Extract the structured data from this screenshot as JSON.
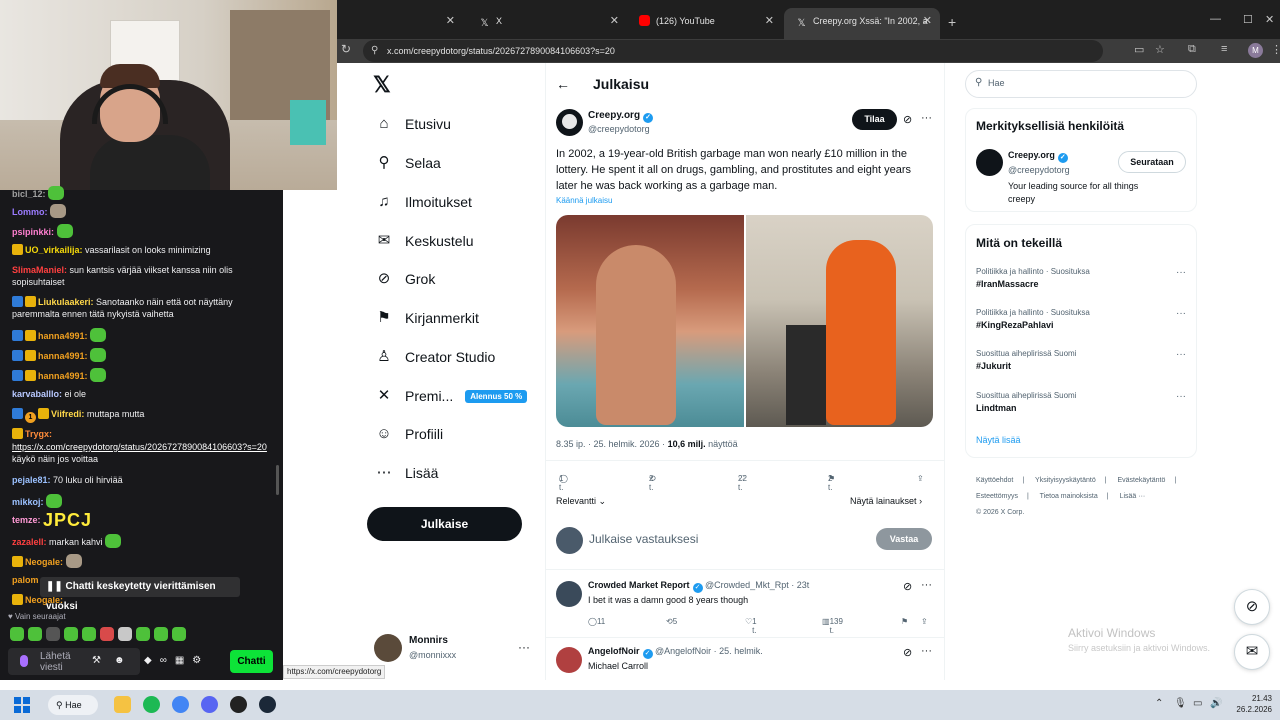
{
  "browser": {
    "tabs": [
      {
        "label": "",
        "active": false
      },
      {
        "label": "X",
        "active": false
      },
      {
        "label": "(126) YouTube",
        "active": false
      },
      {
        "label": "Creepy.org Xssä: \"In 2002, a 19",
        "active": true
      }
    ],
    "url": "x.com/creepydotorg/status/2026727890084106603?s=20",
    "status_url": "https://x.com/creepydotorg"
  },
  "chat": {
    "messages": [
      {
        "user": "bicl_12:",
        "text": ""
      },
      {
        "user": "Lommo:",
        "text": ""
      },
      {
        "user": "psipinkki:",
        "text": ""
      },
      {
        "user": "UO_virkailija:",
        "text": "vassarilasit on looks minimizing"
      },
      {
        "user": "SlimaManiel:",
        "text": "sun kantsis värjää viikset kanssa niin olis sopisuhtaiset"
      },
      {
        "user": "Liukulaakeri:",
        "text": "Sanotaanko näin että oot näyttäny paremmalta ennen tätä nykyistä vaihetta"
      },
      {
        "user": "hanna4991:",
        "text": ""
      },
      {
        "user": "hanna4991:",
        "text": ""
      },
      {
        "user": "hanna4991:",
        "text": ""
      },
      {
        "user": "karvaballlo:",
        "text": "ei ole"
      },
      {
        "user": "Viifredi:",
        "text": "muttapa mutta",
        "badge_num": "1"
      },
      {
        "user": "Trygx:",
        "text": ""
      },
      {
        "user": "",
        "link": "https://x.com/creepydotorg/status/2026727890084106603?s=20",
        "text": "käykö näin jos voittaa"
      },
      {
        "user": "pejale81:",
        "text": "70 luku oli hirviää"
      },
      {
        "user": "mikkoj:",
        "text": ""
      },
      {
        "user": "temze:",
        "text": "JPCJ"
      },
      {
        "user": "zazalell:",
        "text": "markan kahvi"
      },
      {
        "user": "Neogale:",
        "text": ""
      },
      {
        "user": "palom",
        "text": ""
      },
      {
        "user": "Neogale:",
        "text": ""
      }
    ],
    "paused_notice": "Chatti keskeytetty vierittämisen vuoksi",
    "followers_only": "Vain seuraajat",
    "input_placeholder": "Lähetä viesti",
    "send_label": "Chatti"
  },
  "xnav": {
    "items": [
      {
        "label": "Etusivu",
        "icon": "home-icon"
      },
      {
        "label": "Selaa",
        "icon": "search-icon"
      },
      {
        "label": "Ilmoitukset",
        "icon": "bell-icon"
      },
      {
        "label": "Keskustelu",
        "icon": "mail-icon"
      },
      {
        "label": "Grok",
        "icon": "grok-icon"
      },
      {
        "label": "Kirjanmerkit",
        "icon": "bookmark-icon"
      },
      {
        "label": "Creator Studio",
        "icon": "creator-icon"
      },
      {
        "label": "Premi...",
        "icon": "x-icon",
        "promo": "Alennus 50 %"
      },
      {
        "label": "Profiili",
        "icon": "person-icon"
      },
      {
        "label": "Lisää",
        "icon": "more-circle-icon"
      }
    ],
    "post_label": "Julkaise",
    "me_name": "Monnirs",
    "me_handle": "@monnixxx"
  },
  "post": {
    "page_title": "Julkaisu",
    "author_name": "Creepy.org",
    "author_handle": "@creepydotorg",
    "subscribe_label": "Tilaa",
    "text": "In 2002, a 19-year-old British garbage man won nearly £10 million in the lottery. He spent it all on drugs, gambling, and prostitutes and eight years later he was back working as a garbage man.",
    "translate_label": "Käännä julkaisu",
    "time": "8.35 ip. · 25. helmik. 2026 · ",
    "views_num": "10,6 milj.",
    "views_label": " näyttöä",
    "replies": "1 t.",
    "reposts": "2 t.",
    "likes": "22 t.",
    "bookmarks": "2 t.",
    "sort_label": "Relevantti",
    "quotes_label": "Näytä lainaukset",
    "reply_placeholder": "Julkaise vastauksesi",
    "reply_button": "Vastaa"
  },
  "comments": [
    {
      "name": "Crowded Market Report",
      "handle": "@Crowded_Mkt_Rpt · 23t",
      "text": "I bet it was a damn good 8 years though",
      "replies": "11",
      "reposts": "5",
      "likes": "1 t.",
      "views": "139 t."
    },
    {
      "name": "AngelofNoir",
      "handle": "@AngelofNoir · 25. helmik.",
      "text": "Michael Carroll"
    }
  ],
  "sidebar": {
    "search_placeholder": "Hae",
    "who_title": "Merkityksellisiä henkilöitä",
    "who_name": "Creepy.org",
    "who_handle": "@creepydotorg",
    "who_bio": "Your leading source for all things creepy",
    "follow_label": "Seurataan",
    "trends_title": "Mitä on tekeillä",
    "trends": [
      {
        "category": "Politiikka ja hallinto · Suosituksa",
        "tag": "#IranMassacre"
      },
      {
        "category": "Politiikka ja hallinto · Suosituksa",
        "tag": "#KingRezaPahlavi"
      },
      {
        "category": "Suosittua aiheplirissä Suomi",
        "tag": "#Jukurit"
      },
      {
        "category": "Suosittua aiheplirissä Suomi",
        "tag": "Lindtman"
      }
    ],
    "show_more": "Näytä lisää",
    "footer": [
      "Käyttöehdot",
      "|",
      "Yksityisyyskäytäntö",
      "|",
      "Evästekäytäntö",
      "|",
      "Esteettömyys",
      "|",
      "Tietoa mainoksista",
      "|",
      "Lisää ···",
      "© 2026 X Corp."
    ]
  },
  "windows": {
    "activate_title": "Aktivoi Windows",
    "activate_sub": "Siirry asetuksiin ja aktivoi Windows.",
    "search_label": "Hae",
    "time": "21.43",
    "date": "26.2.2026"
  }
}
